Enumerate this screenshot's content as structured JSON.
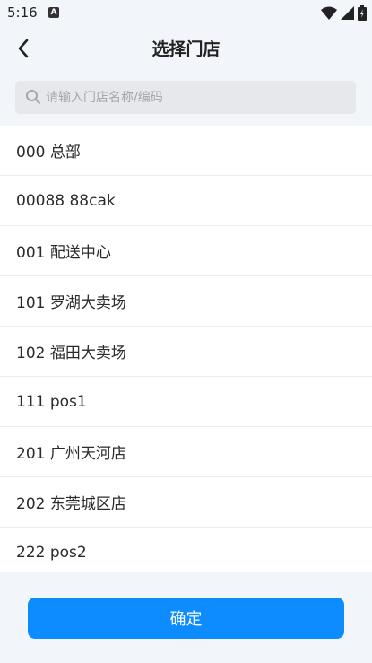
{
  "status_bar": {
    "time": "5:16",
    "notification_icon": "a-icon",
    "icons": [
      "wifi-icon",
      "signal-icon",
      "battery-icon"
    ]
  },
  "header": {
    "title": "选择门店",
    "back_icon": "chevron-left-icon"
  },
  "search": {
    "placeholder": "请输入门店名称/编码",
    "value": ""
  },
  "stores": [
    {
      "label": "000 总部"
    },
    {
      "label": "00088 88cak"
    },
    {
      "label": "001 配送中心"
    },
    {
      "label": "101 罗湖大卖场"
    },
    {
      "label": "102 福田大卖场"
    },
    {
      "label": "111 pos1"
    },
    {
      "label": "201 广州天河店"
    },
    {
      "label": "202 东莞城区店"
    },
    {
      "label": "222 pos2"
    }
  ],
  "footer": {
    "confirm_label": "确定"
  },
  "colors": {
    "accent": "#0d8cff",
    "background": "#f2f5f9",
    "list_background": "#ffffff"
  }
}
